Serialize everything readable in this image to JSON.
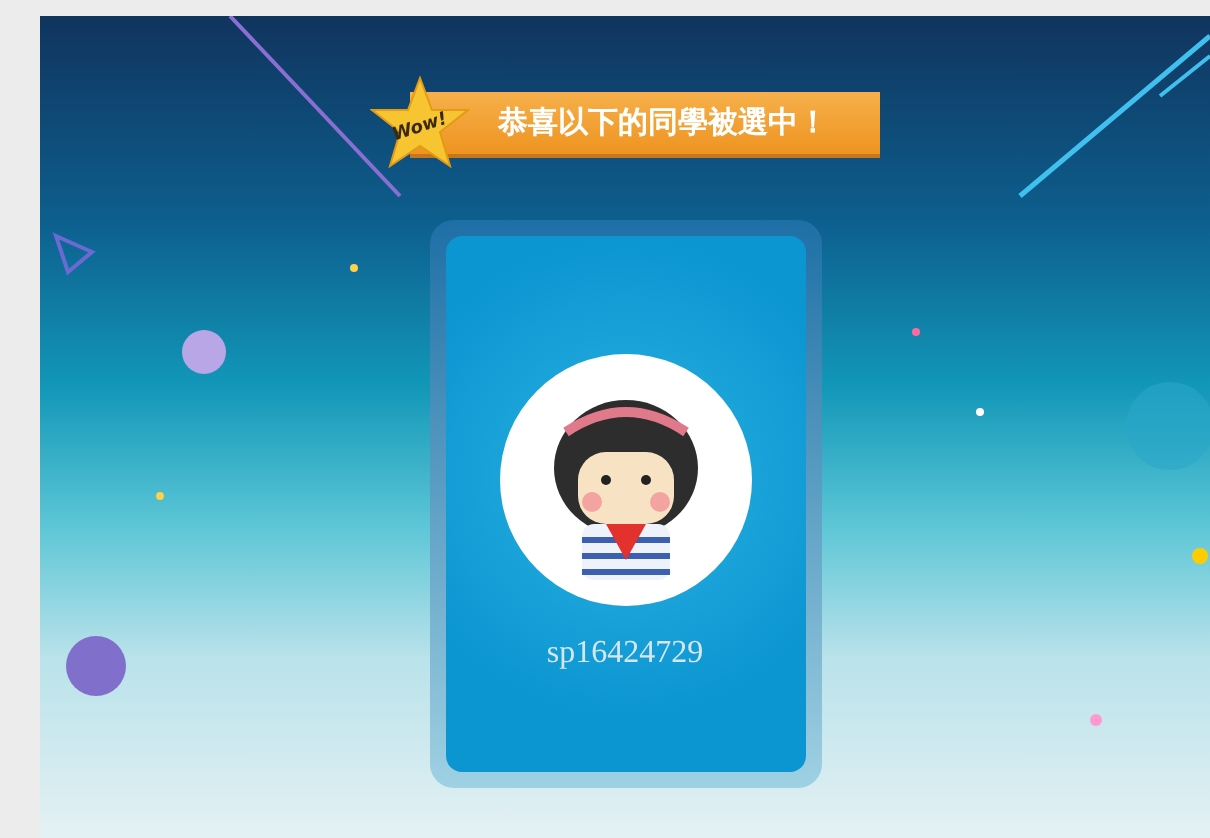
{
  "banner": {
    "badge": "Wow!",
    "title": "恭喜以下的同學被選中！"
  },
  "selected_student": {
    "name": "sp16424729"
  }
}
